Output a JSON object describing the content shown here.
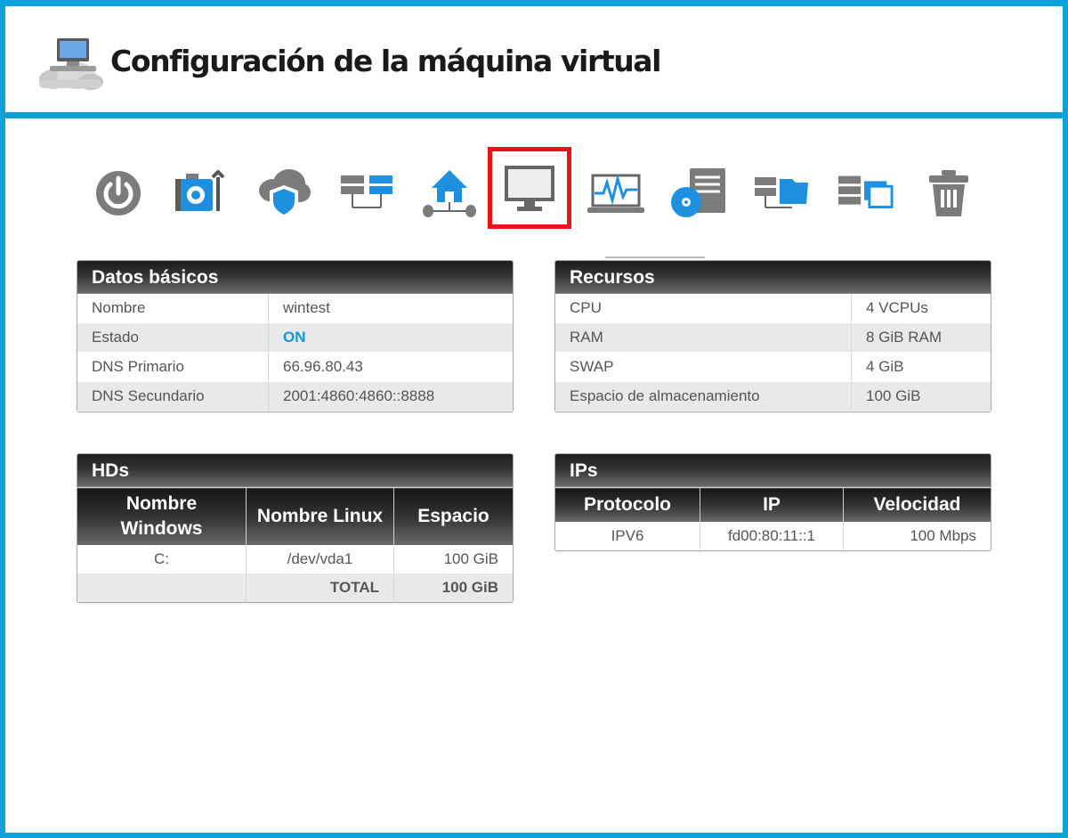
{
  "header": {
    "title": "Configuración de la máquina virtual",
    "logo_icon": "cloud-computer-icon"
  },
  "toolbar": {
    "active_index": 5,
    "icons": [
      "power-icon",
      "toolkit-icon",
      "cloud-shield-icon",
      "servers-network-icon",
      "home-network-icon",
      "monitor-icon",
      "laptop-activity-icon",
      "server-disk-icon",
      "server-folder-icon",
      "server-snapshot-icon",
      "trash-icon"
    ]
  },
  "basic": {
    "title": "Datos básicos",
    "rows": [
      {
        "label": "Nombre",
        "value": "wintest"
      },
      {
        "label": "Estado",
        "value": "ON"
      },
      {
        "label": "DNS Primario",
        "value": "66.96.80.43"
      },
      {
        "label": "DNS Secundario",
        "value": "2001:4860:4860::8888"
      }
    ]
  },
  "resources": {
    "title": "Recursos",
    "rows": [
      {
        "label": "CPU",
        "value": "4 VCPUs"
      },
      {
        "label": "RAM",
        "value": "8 GiB RAM"
      },
      {
        "label": "SWAP",
        "value": "4 GiB"
      },
      {
        "label": "Espacio de almacenamiento",
        "value": "100 GiB"
      }
    ]
  },
  "hds": {
    "title": "HDs",
    "headers": [
      "Nombre Windows",
      "Nombre Linux",
      "Espacio"
    ],
    "rows": [
      {
        "windows": "C:",
        "linux": "/dev/vda1",
        "space": "100 GiB"
      }
    ],
    "total_label": "TOTAL",
    "total_value": "100 GiB"
  },
  "ips": {
    "title": "IPs",
    "headers": [
      "Protocolo",
      "IP",
      "Velocidad"
    ],
    "rows": [
      {
        "protocol": "IPV6",
        "ip": "fd00:80:11::1",
        "speed": "100 Mbps"
      }
    ]
  },
  "colors": {
    "accent": "#0aa2d9",
    "status_on": "#0c99d8",
    "active_tab_border": "#e8131b",
    "icon_gray": "#7b7b7b",
    "icon_blue": "#1e90e0"
  }
}
